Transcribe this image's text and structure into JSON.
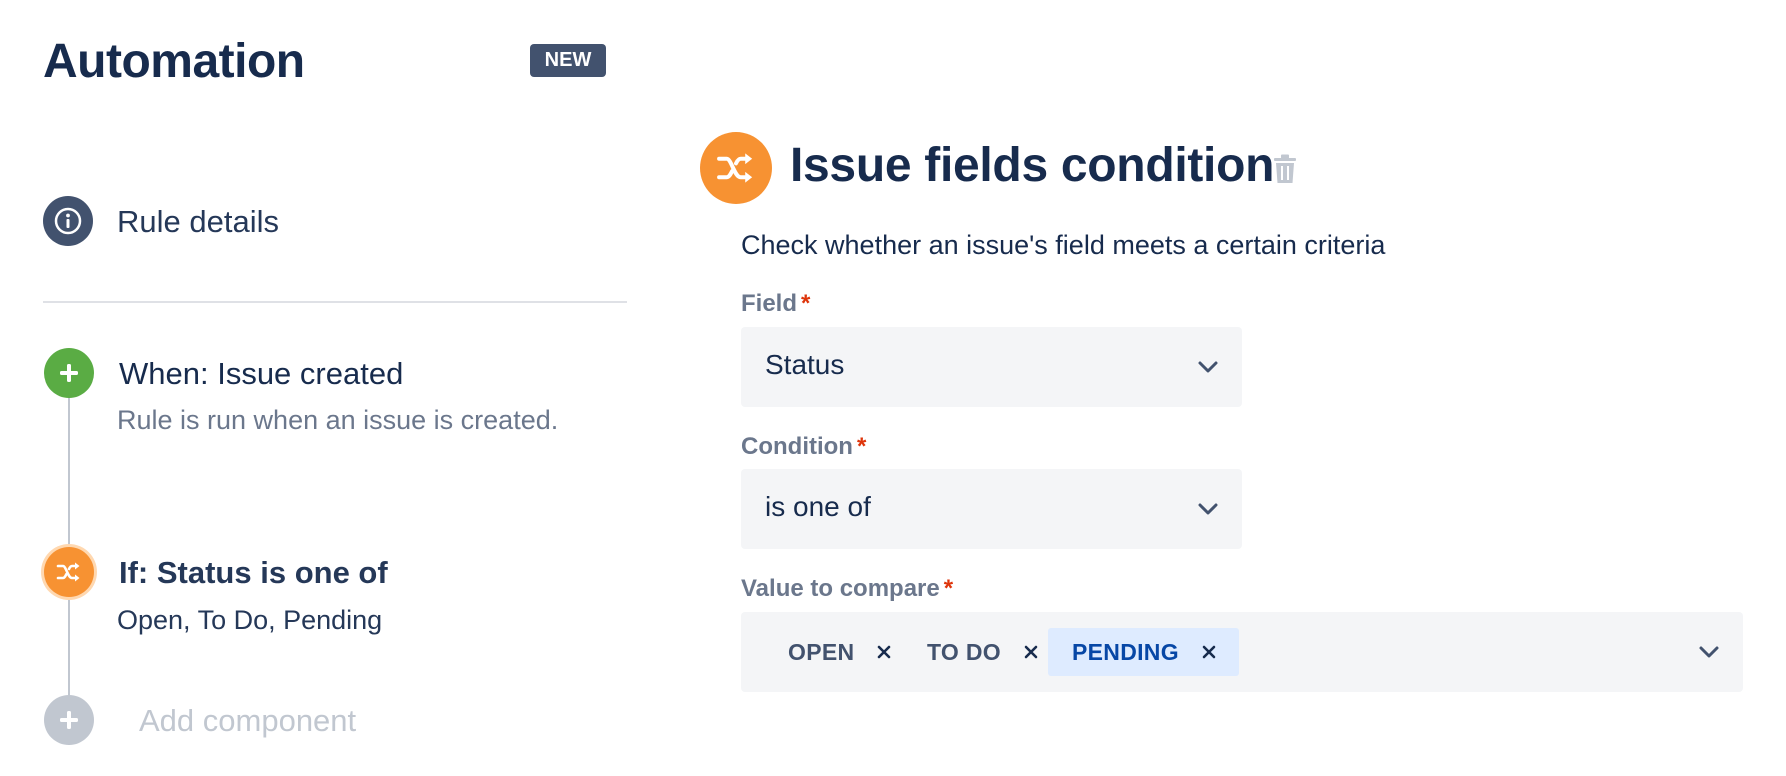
{
  "header": {
    "title": "Automation",
    "badge": "NEW"
  },
  "sidebar": {
    "rule_details": "Rule details",
    "trigger": {
      "title": "When: Issue created",
      "description": "Rule is run when an issue is created."
    },
    "condition": {
      "title": "If: Status is one of",
      "description": "Open, To Do, Pending"
    },
    "add_component": "Add component"
  },
  "panel": {
    "title": "Issue fields condition",
    "description": "Check whether an issue's field meets a certain criteria",
    "field": {
      "label": "Field",
      "required_mark": "*",
      "value": "Status"
    },
    "condition": {
      "label": "Condition",
      "required_mark": "*",
      "value": "is one of"
    },
    "value_to_compare": {
      "label": "Value to compare",
      "required_mark": "*",
      "tags": [
        "OPEN",
        "TO DO",
        "PENDING"
      ]
    }
  },
  "colors": {
    "text_dark": "#172b4d",
    "badge_bg": "#42526e",
    "trigger_green": "#5aac44",
    "condition_orange": "#f79232",
    "disabled_grey": "#c1c7d0",
    "required_red": "#de350b",
    "selected_tag_bg": "#deebff",
    "selected_tag_text": "#0747a6"
  },
  "icons": {
    "rule_details": "info-icon",
    "trigger": "plus-icon",
    "condition": "shuffle-icon",
    "add": "plus-icon",
    "delete": "trash-icon",
    "dropdown": "chevron-down-icon",
    "remove_tag": "close-icon"
  }
}
